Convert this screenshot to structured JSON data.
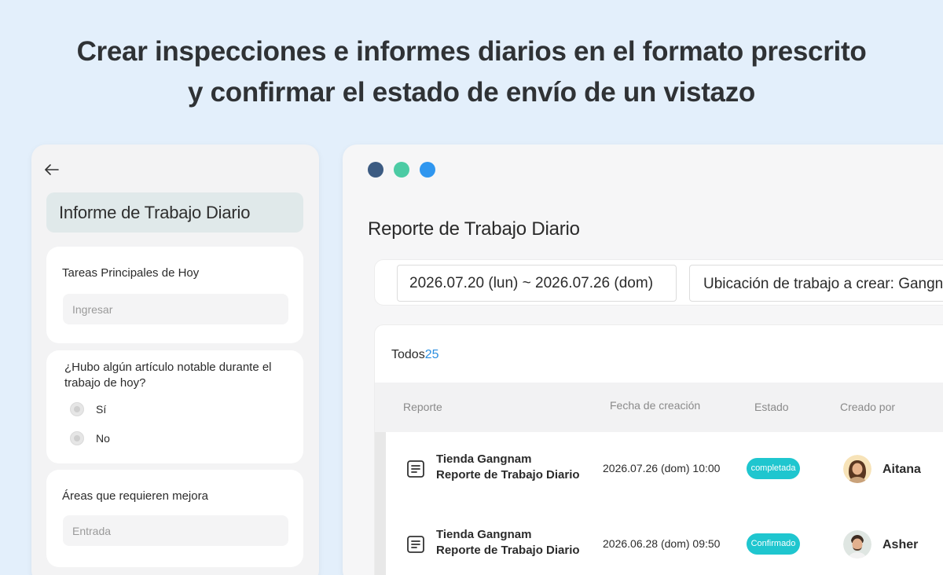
{
  "headline": {
    "line1": "Crear inspecciones e informes diarios en el formato prescrito",
    "line2": "y confirmar el estado de envío de un vistazo"
  },
  "mobile_form": {
    "title": "Informe de Trabajo Diario",
    "q1": {
      "label": "Tareas Principales de Hoy",
      "placeholder": "Ingresar"
    },
    "q2": {
      "label": "¿Hubo algún artículo notable durante el trabajo de hoy?",
      "options": [
        "Sí",
        "No"
      ]
    },
    "q3": {
      "label": "Áreas que requieren mejora",
      "placeholder": "Entrada"
    }
  },
  "desktop": {
    "window_dot_colors": [
      "#3c5b82",
      "#4ccba4",
      "#2f96ef"
    ],
    "page_title": "Reporte de Trabajo Diario",
    "filters": {
      "date_range": "2026.07.20 (lun) ~ 2026.07.26 (dom)",
      "location": "Ubicación de trabajo a crear: Gangnam"
    },
    "list": {
      "all_label": "Todos",
      "count": "25",
      "columns": {
        "report": "Reporte",
        "created": "Fecha de creación",
        "status": "Estado",
        "author": "Creado por"
      },
      "rows": [
        {
          "title_line1": "Tienda Gangnam",
          "title_line2": "Reporte de Trabajo Diario",
          "created": "2026.07.26 (dom) 10:00",
          "status": "completada",
          "author": "Aitana"
        },
        {
          "title_line1": "Tienda Gangnam",
          "title_line2": "Reporte de Trabajo Diario",
          "created": "2026.06.28 (dom) 09:50",
          "status": "Confirmado",
          "author": "Asher"
        }
      ]
    },
    "status_color": "#1fc6cf",
    "accent_color": "#2a8ee0"
  }
}
